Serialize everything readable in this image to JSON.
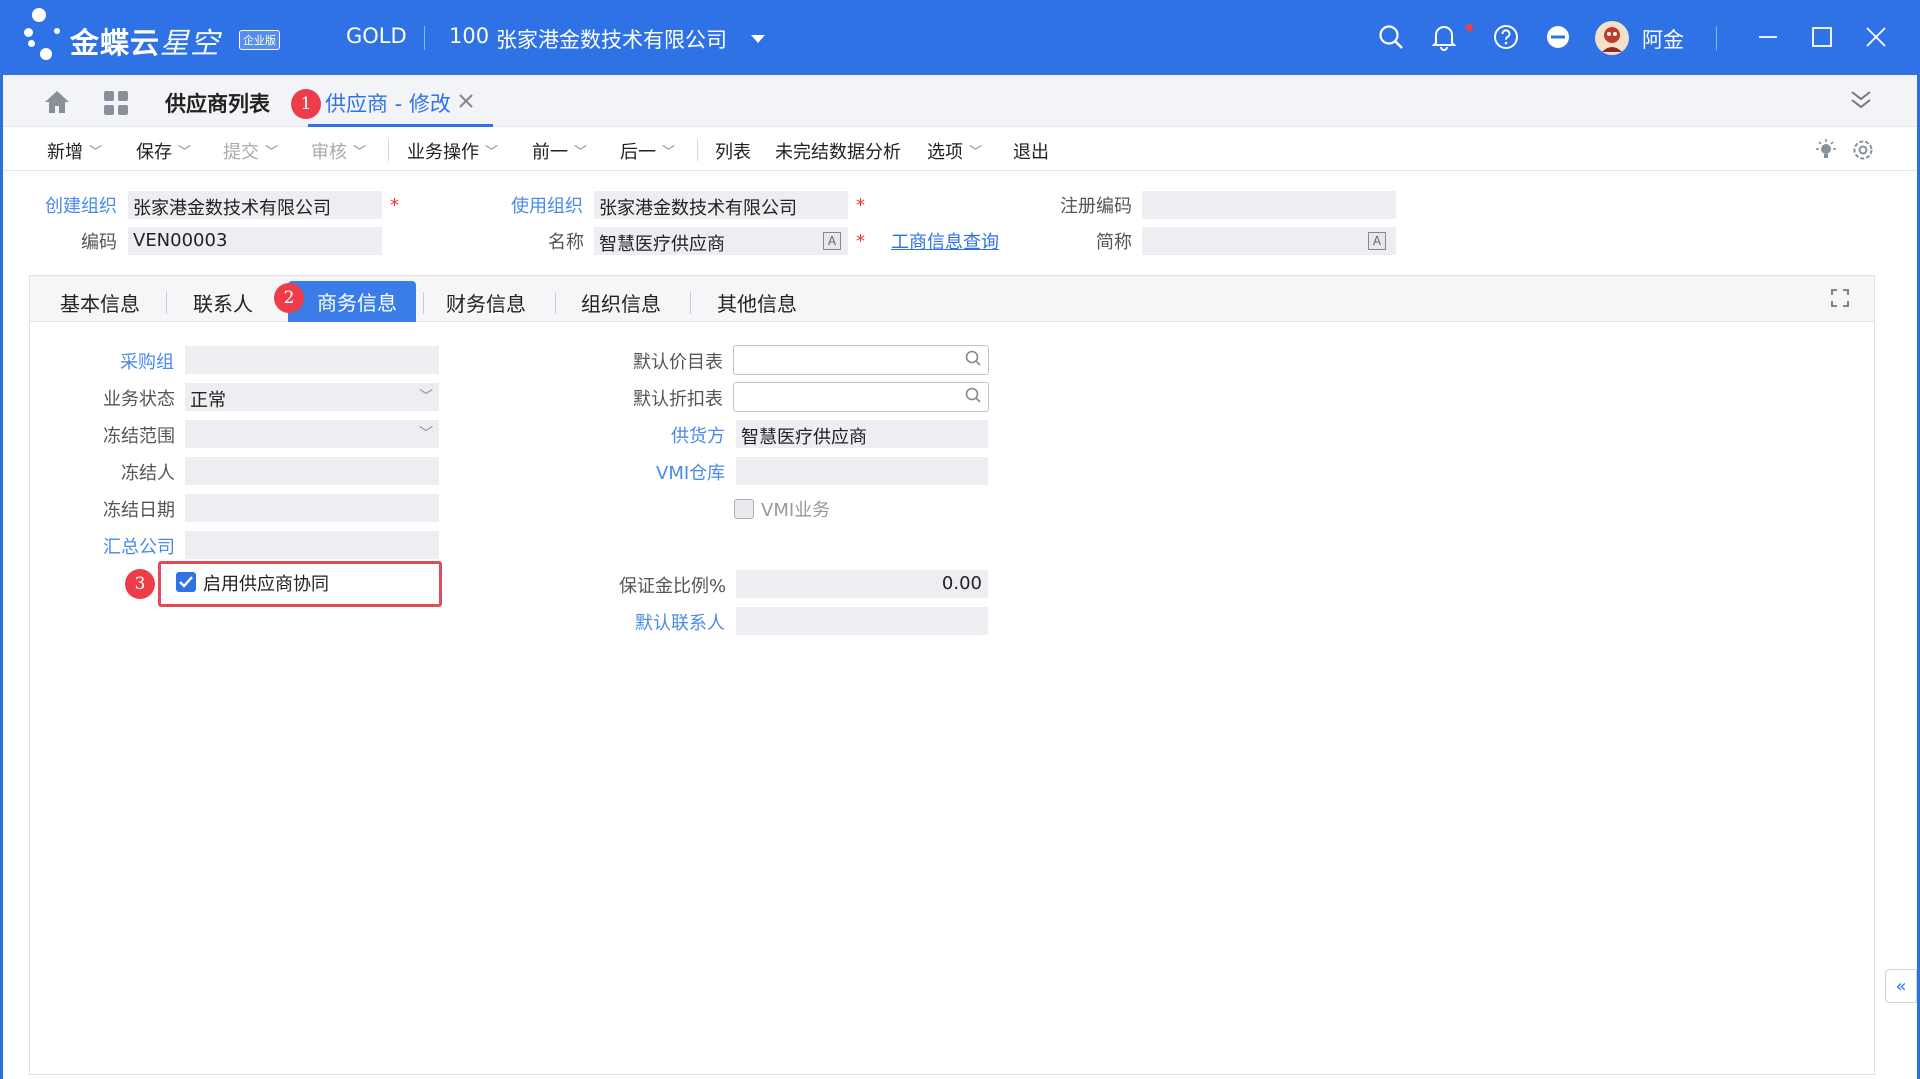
{
  "app": {
    "logo_text": "金蝶云",
    "logo_sub": "星空",
    "edition_badge": "企业版",
    "data_center": "GOLD",
    "org_code": "100",
    "org_name": "张家港金数技术有限公司",
    "user_name": "阿金"
  },
  "tabs": {
    "list_tab": "供应商列表",
    "active_tab": "供应商 - 修改",
    "active_badge": "1"
  },
  "toolbar": {
    "new": "新增",
    "save": "保存",
    "submit": "提交",
    "audit": "审核",
    "business_ops": "业务操作",
    "prev": "前一",
    "next": "后一",
    "list": "列表",
    "analysis": "未完结数据分析",
    "options": "选项",
    "exit": "退出"
  },
  "header": {
    "create_org_label": "创建组织",
    "create_org_value": "张家港金数技术有限公司",
    "use_org_label": "使用组织",
    "use_org_value": "张家港金数技术有限公司",
    "reg_code_label": "注册编码",
    "reg_code_value": "",
    "code_label": "编码",
    "code_value": "VEN00003",
    "name_label": "名称",
    "name_value": "智慧医疗供应商",
    "biz_query_link": "工商信息查询",
    "short_name_label": "简称",
    "short_name_value": "",
    "required_mark": "*",
    "multilang_mark": "A"
  },
  "subtabs": {
    "basic": "基本信息",
    "contact": "联系人",
    "business": "商务信息",
    "business_badge": "2",
    "finance": "财务信息",
    "org": "组织信息",
    "other": "其他信息"
  },
  "business": {
    "purchase_group_label": "采购组",
    "purchase_group_value": "",
    "biz_status_label": "业务状态",
    "biz_status_value": "正常",
    "freeze_scope_label": "冻结范围",
    "freeze_scope_value": "",
    "freezer_label": "冻结人",
    "freezer_value": "",
    "freeze_date_label": "冻结日期",
    "freeze_date_value": "",
    "summary_company_label": "汇总公司",
    "summary_company_value": "",
    "enable_collab_label": "启用供应商协同",
    "enable_collab_checked": true,
    "collab_badge": "3",
    "default_price_list_label": "默认价目表",
    "default_price_list_value": "",
    "default_discount_label": "默认折扣表",
    "default_discount_value": "",
    "supplier_party_label": "供货方",
    "supplier_party_value": "智慧医疗供应商",
    "vmi_warehouse_label": "VMI仓库",
    "vmi_warehouse_value": "",
    "vmi_business_label": "VMI业务",
    "vmi_business_checked": false,
    "deposit_ratio_label": "保证金比例%",
    "deposit_ratio_value": "0.00",
    "default_contact_label": "默认联系人",
    "default_contact_value": ""
  },
  "colors": {
    "brand_blue": "#2f72e6",
    "link_blue": "#4a8ae8",
    "badge_red": "#ee3d4a",
    "highlight_red": "#e54a5a"
  },
  "icons": [
    "search-icon",
    "bell-icon",
    "help-icon",
    "minus-circle-icon",
    "avatar",
    "minimize-icon",
    "maximize-icon",
    "close-icon",
    "home-icon",
    "apps-icon",
    "collapse-icon",
    "bulb-icon",
    "gear-icon",
    "fullscreen-icon",
    "double-chevron-left-icon"
  ]
}
